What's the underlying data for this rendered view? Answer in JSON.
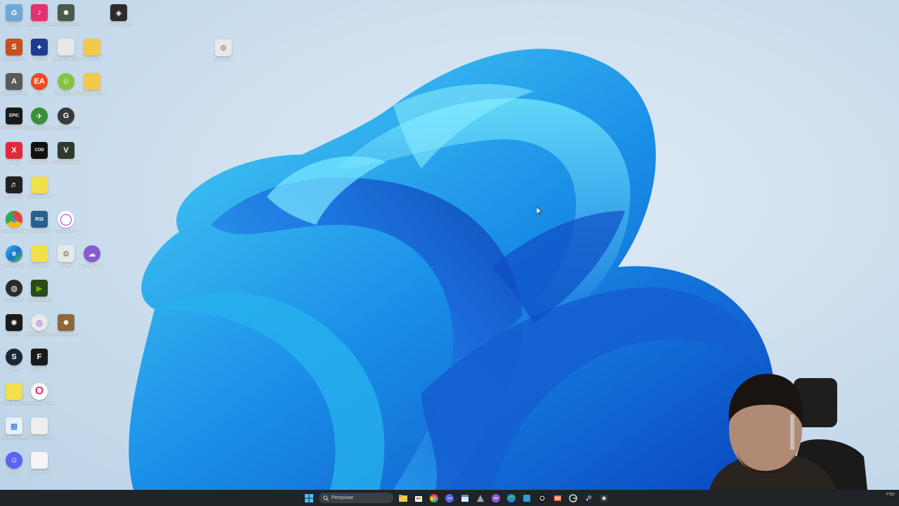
{
  "desktop": {
    "icons": [
      {
        "name": "recycle-bin-icon",
        "label": "Lixeira",
        "bg": "#6fa8d6",
        "glyph": "♻"
      },
      {
        "name": "tiktok-live-studio-icon",
        "label": "TikTok LIVE Studio",
        "bg": "#e0336f",
        "glyph": "♪"
      },
      {
        "name": "escape-from-tarkov-icon",
        "label": "Escape from Tarkov",
        "bg": "#4a5a4a",
        "glyph": "☻"
      },
      {
        "name": "app-icon",
        "label": "SetupMa... Admin",
        "bg": "#2b2b2b",
        "glyph": "◈"
      },
      {
        "name": "scum-icon",
        "label": "SCUM Admin...",
        "bg": "#c8501e",
        "glyph": "S"
      },
      {
        "name": "app-icon",
        "label": "Discord",
        "bg": "#1d3d8f",
        "glyph": "✦"
      },
      {
        "name": "file-icon",
        "label": "Setup do conecta...",
        "bg": "#e8e8e8",
        "glyph": ""
      },
      {
        "name": "folder-icon",
        "label": "media Profit...",
        "bg": "#f2c94c",
        "glyph": ""
      },
      {
        "name": "app-icon",
        "label": "Battlestate Games L...",
        "bg": "#5a5a5a",
        "glyph": "A"
      },
      {
        "name": "ea-icon",
        "label": "EA",
        "bg": "#ef4a23",
        "glyph": "EA"
      },
      {
        "name": "app-icon",
        "label": "Teste de Entrega",
        "bg": "#86c440",
        "glyph": "☺"
      },
      {
        "name": "folder-icon",
        "label": "Arquivos Profits",
        "bg": "#f2c94c",
        "glyph": ""
      },
      {
        "name": "epic-games-icon",
        "label": "Epic Games Launcher",
        "bg": "#1a1a1a",
        "glyph": "EPIC"
      },
      {
        "name": "msi-afterburner-icon",
        "label": "MSI Afterburner",
        "bg": "#3a8f3a",
        "glyph": "✈"
      },
      {
        "name": "logitech-icon",
        "label": "Logitech G HUB",
        "bg": "#3a3a3a",
        "glyph": "G"
      },
      {
        "name": "app-icon",
        "label": "Exitlag",
        "bg": "#e02a3a",
        "glyph": "X"
      },
      {
        "name": "call-of-duty-icon",
        "label": "Call of Duty ®",
        "bg": "#111111",
        "glyph": "COD"
      },
      {
        "name": "gray-zone-icon",
        "label": "Gray Zone Warfare",
        "bg": "#2f3a2f",
        "glyph": "V"
      },
      {
        "name": "app-icon",
        "label": "NBC Rádio",
        "bg": "#222",
        "glyph": "♬"
      },
      {
        "name": "folder-icon",
        "label": "Documentos (1)",
        "bg": "#f2e04c",
        "glyph": ""
      },
      {
        "name": "chrome-icon",
        "label": "Google Chrome",
        "bg": "#ffffff",
        "glyph": "◉"
      },
      {
        "name": "rsi-launcher-icon",
        "label": "RSI Launcher",
        "bg": "#2a5f8f",
        "glyph": "RSI"
      },
      {
        "name": "app-icon",
        "label": "OBS GALAXY",
        "bg": "#ffffff",
        "glyph": "◯"
      },
      {
        "name": "edge-icon",
        "label": "Microsoft Edge",
        "bg": "#1a8fd6",
        "glyph": "e"
      },
      {
        "name": "folder-icon",
        "label": "Glufas Mult...",
        "bg": "#f2e04c",
        "glyph": ""
      },
      {
        "name": "app-icon",
        "label": "Google",
        "bg": "#e8e8e8",
        "glyph": "⚙"
      },
      {
        "name": "app-icon",
        "label": "Discord Jam",
        "bg": "#8a5bd0",
        "glyph": "☁"
      },
      {
        "name": "obs-icon",
        "label": "OBS Studio",
        "bg": "#2a2a2a",
        "glyph": "◍"
      },
      {
        "name": "nvidia-icon",
        "label": "NVIDIA Broadcast",
        "bg": "#2a4a1a",
        "glyph": "▶"
      },
      {
        "name": "app-icon",
        "label": "Hydra",
        "bg": "#1a1a1a",
        "glyph": "✺"
      },
      {
        "name": "app-icon",
        "label": "Webcam Camera",
        "bg": "#e8e8e8",
        "glyph": "◎"
      },
      {
        "name": "app-icon",
        "label": "Os Farpanalt(PT)",
        "bg": "#8a6a3a",
        "glyph": "☻"
      },
      {
        "name": "steam-icon",
        "label": "Steam",
        "bg": "#1b2838",
        "glyph": "S"
      },
      {
        "name": "app-icon",
        "label": "Demobbm",
        "bg": "#1a1a1a",
        "glyph": "F"
      },
      {
        "name": "folder-icon",
        "label": "Documentos Ecológicos",
        "bg": "#f2e04c",
        "glyph": ""
      },
      {
        "name": "opera-icon",
        "label": "Navegador Opera GX",
        "bg": "#ffffff",
        "glyph": "O"
      },
      {
        "name": "app-icon",
        "label": "Flag Slying Light 16...",
        "bg": "#e8f0f8",
        "glyph": "▦"
      },
      {
        "name": "file-icon",
        "label": "Mc Fé nada (Bern) jo...",
        "bg": "#eeeeee",
        "glyph": ""
      },
      {
        "name": "discord-icon",
        "label": "Discord",
        "bg": "#5865f2",
        "glyph": "☺"
      },
      {
        "name": "file-icon",
        "label": "Fechamento",
        "bg": "#f5f5f5",
        "glyph": ""
      },
      {
        "name": "app-icon",
        "label": "comandos...",
        "bg": "#e8e8e8",
        "glyph": "⚙"
      }
    ]
  },
  "taskbar": {
    "search_placeholder": "Pesquisar",
    "apps": [
      "file-explorer-icon",
      "store-icon",
      "chrome-icon",
      "discord-icon",
      "app-icon",
      "app-icon",
      "messenger-icon",
      "edge-icon",
      "app-icon",
      "app-icon",
      "app-icon",
      "steam-icon",
      "app-icon"
    ],
    "tray_text": "PTB2"
  }
}
